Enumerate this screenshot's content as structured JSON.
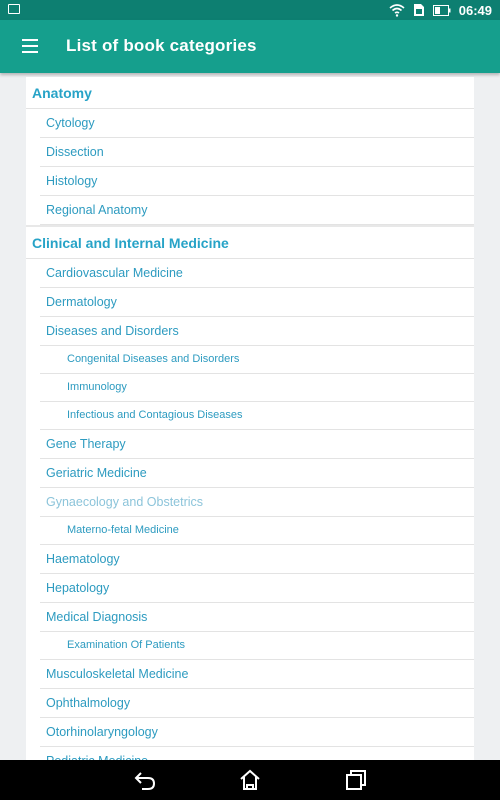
{
  "status": {
    "time": "06:49",
    "icons": [
      "image-icon",
      "wifi-icon",
      "sim-icon",
      "battery-icon"
    ]
  },
  "appbar": {
    "title": "List of book categories",
    "menu_icon": "hamburger-menu-icon"
  },
  "sections": [
    {
      "name": "Anatomy",
      "items": [
        {
          "label": "Cytology"
        },
        {
          "label": "Dissection"
        },
        {
          "label": "Histology"
        },
        {
          "label": "Regional Anatomy"
        }
      ]
    },
    {
      "name": "Clinical and Internal Medicine",
      "items": [
        {
          "label": "Cardiovascular Medicine"
        },
        {
          "label": "Dermatology"
        },
        {
          "label": "Diseases and Disorders",
          "children": [
            {
              "label": "Congenital Diseases and Disorders"
            },
            {
              "label": "Immunology"
            },
            {
              "label": "Infectious and Contagious Diseases"
            }
          ]
        },
        {
          "label": "Gene Therapy"
        },
        {
          "label": "Geriatric Medicine"
        },
        {
          "label": "Gynaecology and Obstetrics",
          "dim": true,
          "children": [
            {
              "label": "Materno-fetal Medicine"
            }
          ]
        },
        {
          "label": "Haematology"
        },
        {
          "label": "Hepatology"
        },
        {
          "label": "Medical Diagnosis",
          "children": [
            {
              "label": "Examination Of Patients"
            }
          ]
        },
        {
          "label": "Musculoskeletal Medicine"
        },
        {
          "label": "Ophthalmology"
        },
        {
          "label": "Otorhinolaryngology"
        },
        {
          "label": "Pediatric Medicine"
        }
      ]
    }
  ],
  "colors": {
    "statusbar": "#0d7f71",
    "appbar": "#159f8d",
    "section_text": "#27a3c7",
    "item_text": "#2d9bc0",
    "background": "#eef0f2"
  },
  "navbar": {
    "buttons": [
      "back-icon",
      "home-icon",
      "recents-icon"
    ]
  }
}
